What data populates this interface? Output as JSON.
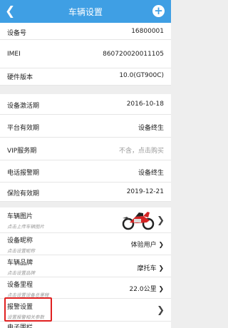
{
  "header": {
    "title": "车辆设置",
    "back_icon": "back-icon",
    "add_icon": "add-icon"
  },
  "device_info": [
    {
      "label": "设备号",
      "value": "16800001"
    },
    {
      "label": "IMEI",
      "value": "860720020011105"
    },
    {
      "label": "硬件版本",
      "value": "10.0(GT900C)"
    }
  ],
  "service_info": [
    {
      "label": "设备激活期",
      "value": "2016-10-18"
    },
    {
      "label": "平台有效期",
      "value": "设备终生"
    },
    {
      "label": "VIP服务期",
      "value": "不含，点击购买"
    },
    {
      "label": "电话报警期",
      "value": "设备终生"
    },
    {
      "label": "保险有效期",
      "value": "2019-12-21"
    }
  ],
  "settings": [
    {
      "label": "车辆图片",
      "sub": "点击上传车辆图片",
      "value": ""
    },
    {
      "label": "设备昵称",
      "sub": "点击设置昵称",
      "value": "体验用户"
    },
    {
      "label": "车辆品牌",
      "sub": "点击设置品牌",
      "value": "摩托车"
    },
    {
      "label": "设备里程",
      "sub": "点击设置设备总里程",
      "value": "22.0公里"
    },
    {
      "label": "报警设置",
      "sub": "设置报警相关参数",
      "value": ""
    },
    {
      "label": "电子围栏",
      "sub": "",
      "value": ""
    }
  ],
  "colors": {
    "header": "#3f9fe4",
    "highlight": "#e02020"
  }
}
